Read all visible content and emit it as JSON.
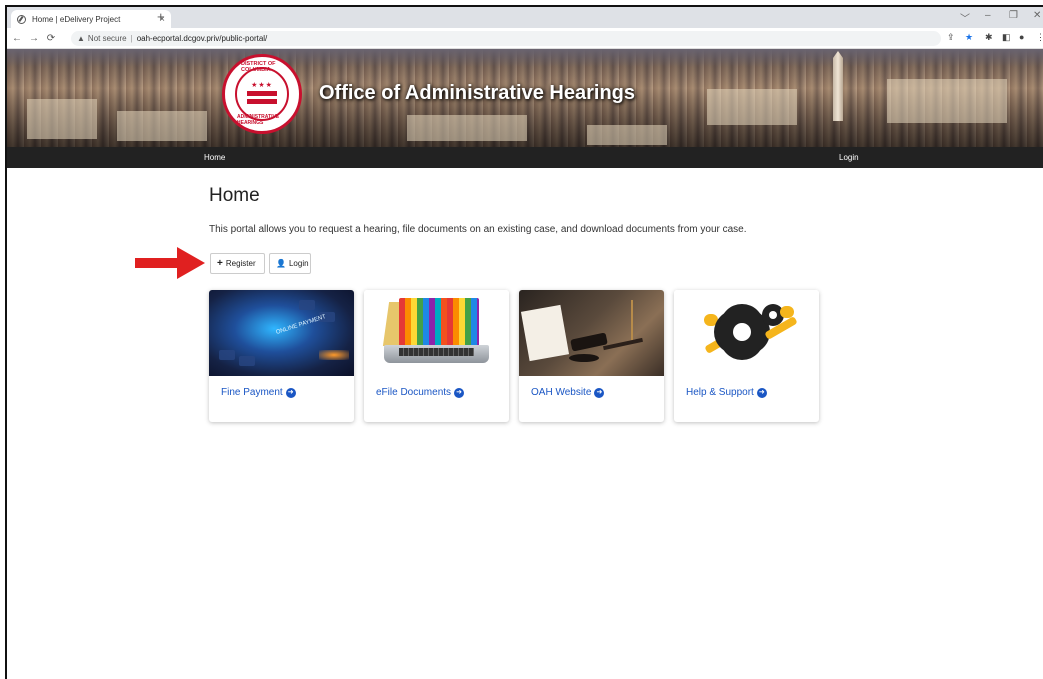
{
  "browser": {
    "tab_title": "Home | eDelivery Project",
    "tab_close": "×",
    "new_tab": "+",
    "not_secure": "Not secure",
    "url": "oah-ecportal.dcgov.priv/public-portal/",
    "window_controls": [
      "﹀",
      "–",
      "❐",
      "✕"
    ]
  },
  "banner": {
    "title": "Office of Administrative Hearings",
    "seal_text_top": "DISTRICT OF COLUMBIA",
    "seal_text_bottom": "ADMINISTRATIVE HEARINGS"
  },
  "nav": {
    "home": "Home",
    "login": "Login"
  },
  "main": {
    "title": "Home",
    "intro": "This portal allows you to request a hearing, file documents on an existing case, and download documents from your case.",
    "register_label": "Register",
    "login_label": "Login"
  },
  "cards": [
    {
      "label": "Fine Payment",
      "image_text": "ONLINE PAYMENT"
    },
    {
      "label": "eFile Documents"
    },
    {
      "label": "OAH Website"
    },
    {
      "label": "Help & Support"
    }
  ],
  "colors": {
    "accent": "#1a56c4",
    "navbar": "#222222",
    "seal_red": "#c8102e",
    "annotation_arrow": "#e02020"
  }
}
